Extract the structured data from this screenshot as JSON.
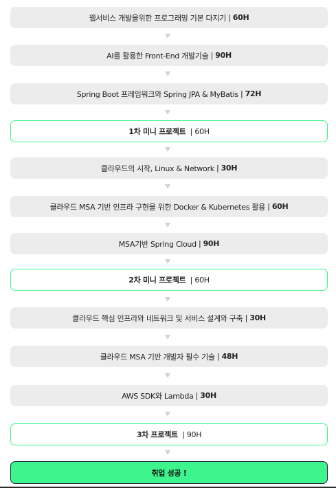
{
  "steps": [
    {
      "name": "웹서비스 개발을위한 프로그래밍 기본 다지기",
      "sep": " | ",
      "hours": "60H",
      "kind": "course"
    },
    {
      "name": "AI를 활용한 Front-End 개발기술",
      "sep": " | ",
      "hours": "90H",
      "kind": "course"
    },
    {
      "name": "Spring Boot 프레임워크와 Spring JPA & MyBatis",
      "sep": " | ",
      "hours": "72H",
      "kind": "course"
    },
    {
      "name": "1차 미니 프로젝트",
      "sep": "  | ",
      "hours": "60H",
      "kind": "project"
    },
    {
      "name": "클라우드의 시작, Linux & Network",
      "sep": " | ",
      "hours": "30H",
      "kind": "course"
    },
    {
      "name": "클라우드 MSA 기반 인프라 구현을 위한 Docker & Kubernetes 활용",
      "sep": " | ",
      "hours": "60H",
      "kind": "course"
    },
    {
      "name": "MSA기반 Spring Cloud",
      "sep": " | ",
      "hours": "90H",
      "kind": "course"
    },
    {
      "name": "2차 미니 프로젝트",
      "sep": "  | ",
      "hours": "60H",
      "kind": "project"
    },
    {
      "name": "클라우드 핵심 인프라와 네트워크 및 서비스 설계와 구축",
      "sep": " | ",
      "hours": "30H",
      "kind": "course"
    },
    {
      "name": "클라우드 MSA 기반 개발자 필수 기술",
      "sep": " | ",
      "hours": "48H",
      "kind": "course"
    },
    {
      "name": "AWS SDK와 Lambda",
      "sep": " | ",
      "hours": "30H",
      "kind": "course"
    },
    {
      "name": "3차 프로젝트",
      "sep": "  | ",
      "hours": "90H",
      "kind": "project"
    }
  ],
  "final": {
    "label": "취업 성공 !"
  }
}
